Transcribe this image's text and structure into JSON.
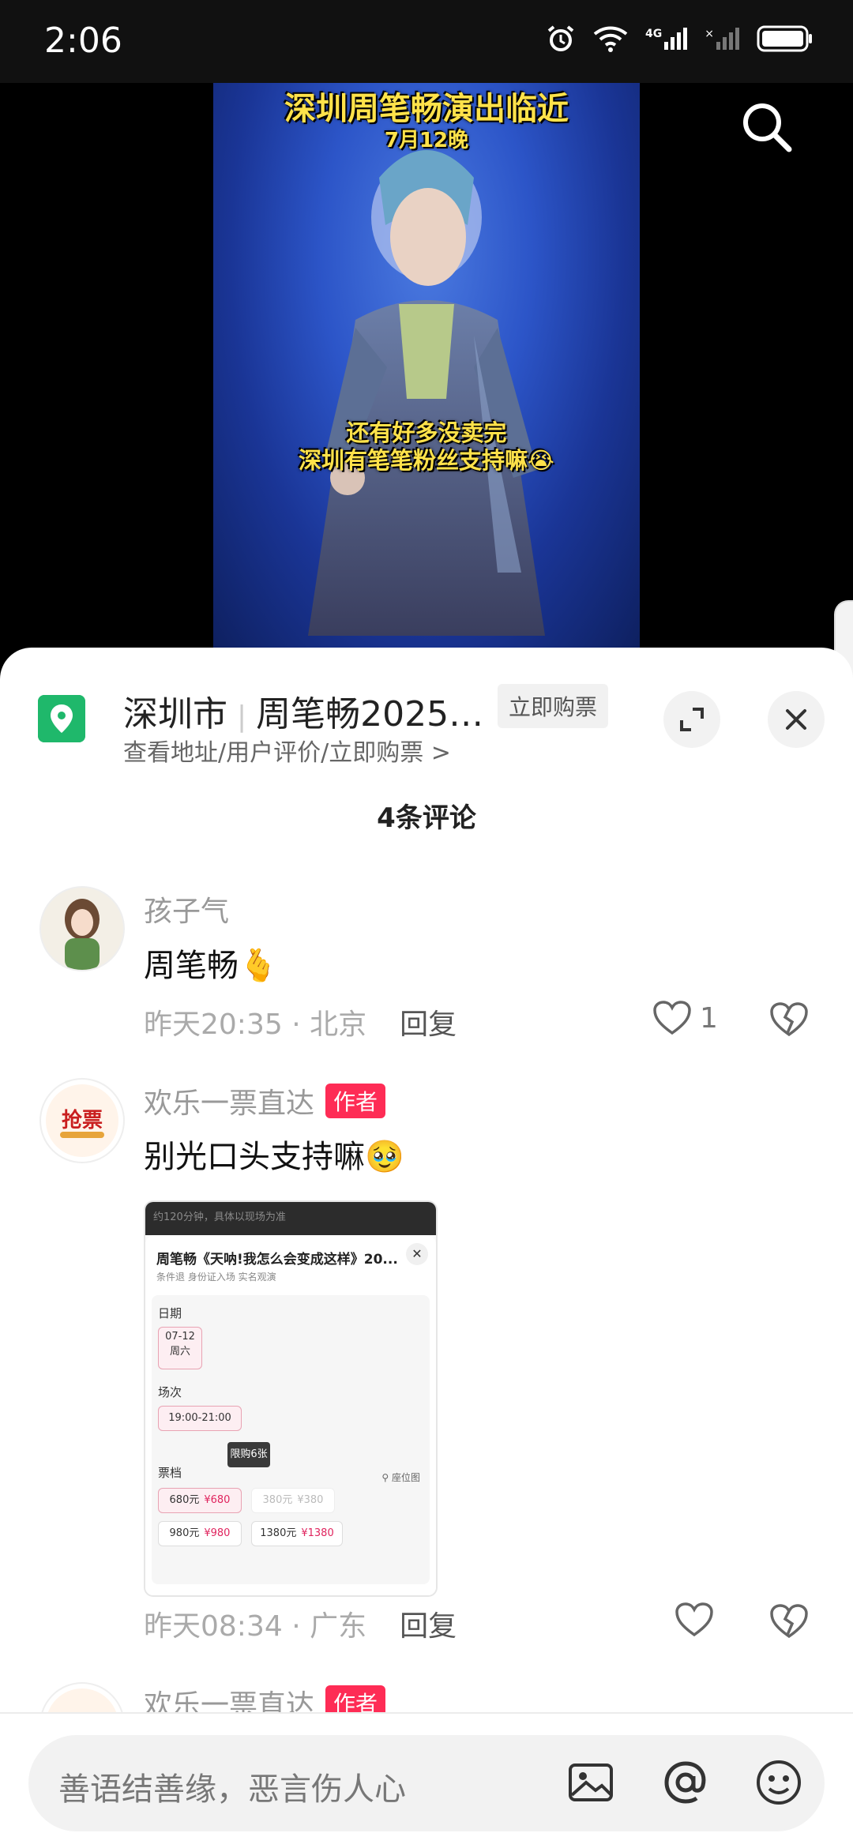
{
  "status_bar": {
    "time": "2:06",
    "network": "4G"
  },
  "video": {
    "caption_title": "深圳周笔畅演出临近",
    "caption_date": "7月12晚",
    "caption_line1": "还有好多没卖完",
    "caption_line2": "深圳有笔笔粉丝支持嘛😭"
  },
  "location_bar": {
    "city": "深圳市",
    "event": "周笔畅2025…",
    "buy_tag": "立即购票",
    "subtitle": "查看地址/用户评价/立即购票 >"
  },
  "comments_header": {
    "count_label": "4条评论"
  },
  "comments": [
    {
      "username": "孩子气",
      "text": "周笔畅🫰",
      "time": "昨天20:35",
      "location": "北京",
      "reply_label": "回复",
      "likes": "1"
    },
    {
      "username": "欢乐一票直达",
      "author_tag": "作者",
      "text": "别光口头支持嘛🥹",
      "time": "昨天08:34",
      "location": "广东",
      "reply_label": "回复",
      "likes": ""
    },
    {
      "username": "欢乐一票直达",
      "author_tag": "作者"
    }
  ],
  "ticket_screenshot": {
    "top_text": "约120分钟，具体以现场为准",
    "title": "周笔畅《天呐!我怎么会变成这样》20...",
    "subtitle": "条件退  身份证入场  实名观演",
    "date_label": "日期",
    "date_value": "07-12",
    "date_weekday": "周六",
    "session_label": "场次",
    "session_value": "19:00-21:00",
    "limit_label": "限购6张",
    "tier_label": "票档",
    "seat_map_label": "座位图",
    "tiers": [
      {
        "name": "680元",
        "price": "¥680"
      },
      {
        "name": "380元",
        "price": "¥380"
      },
      {
        "name": "980元",
        "price": "¥980"
      },
      {
        "name": "1380元",
        "price": "¥1380"
      }
    ]
  },
  "input_bar": {
    "placeholder": "善语结善缘，恶言伤人心"
  }
}
